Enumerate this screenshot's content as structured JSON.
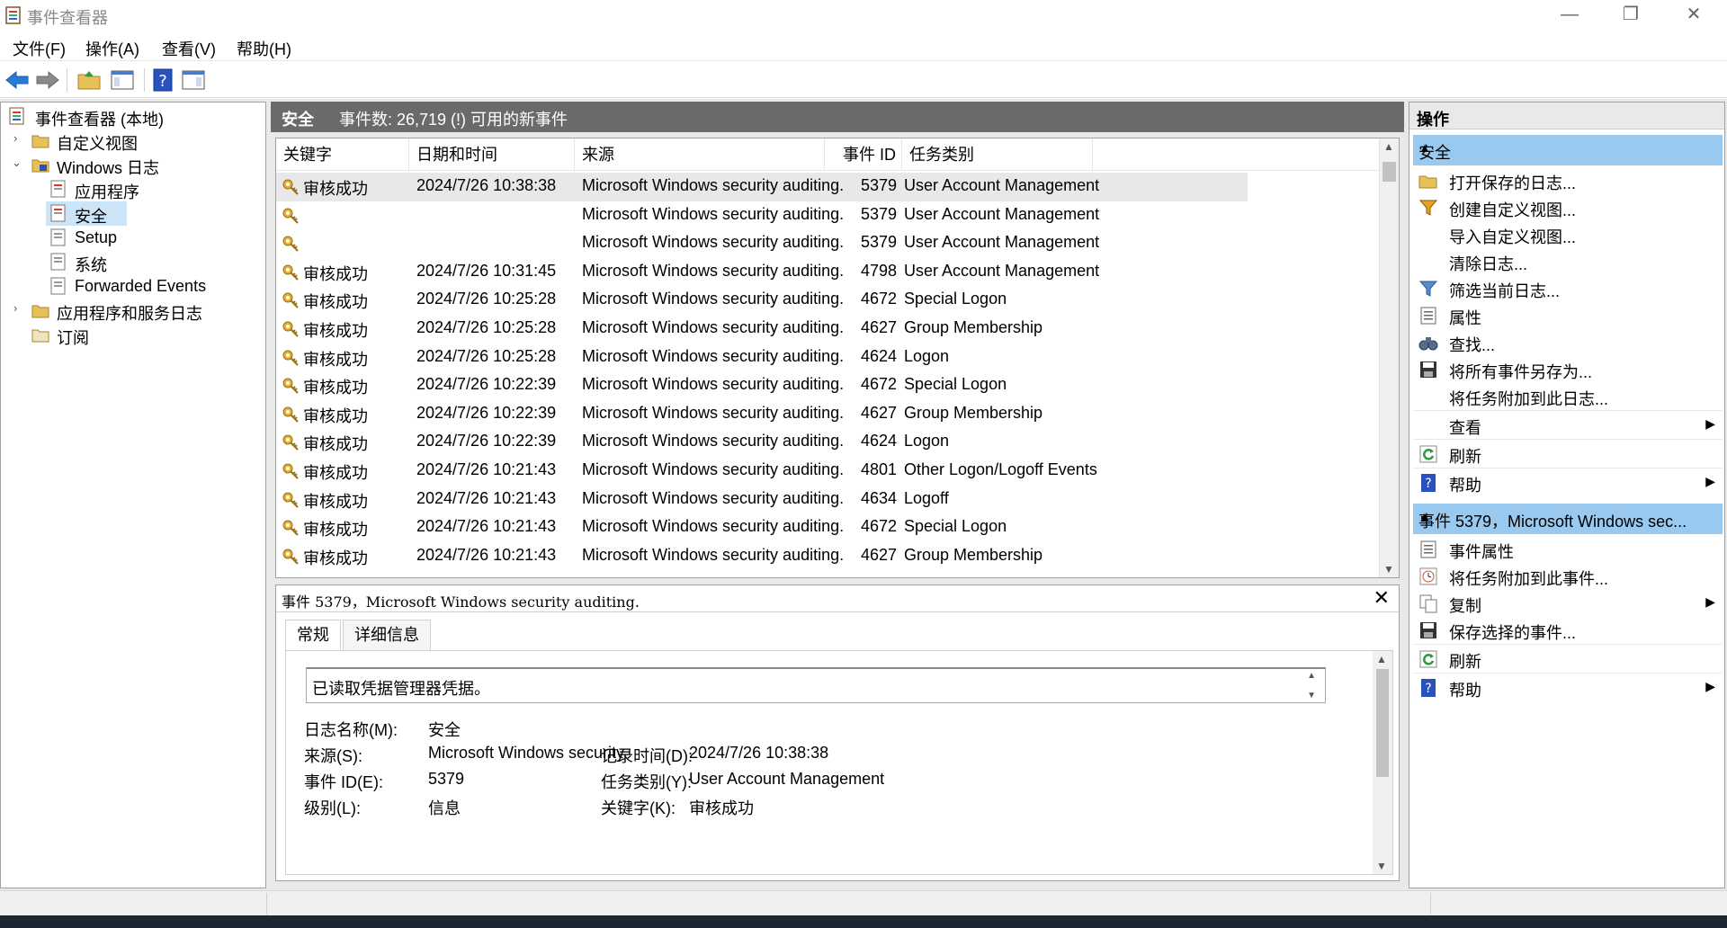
{
  "window": {
    "title": "事件查看器"
  },
  "menu": [
    "文件(F)",
    "操作(A)",
    "查看(V)",
    "帮助(H)"
  ],
  "tree": {
    "root": "事件查看器 (本地)",
    "custom_views": "自定义视图",
    "windows_logs": "Windows 日志",
    "application": "应用程序",
    "security": "安全",
    "setup": "Setup",
    "system": "系统",
    "forwarded": "Forwarded Events",
    "apps_services": "应用程序和服务日志",
    "subscriptions": "订阅"
  },
  "center": {
    "title": "安全",
    "count_text": "事件数: 26,719 (!) 可用的新事件"
  },
  "columns": {
    "keyword": "关键字",
    "datetime": "日期和时间",
    "source": "来源",
    "event_id": "事件 ID",
    "task": "任务类别"
  },
  "events": [
    {
      "keyword": "审核成功",
      "datetime": "2024/7/26 10:38:38",
      "source": "Microsoft Windows security auditing.",
      "id": "5379",
      "task": "User Account Management"
    },
    {
      "keyword": "",
      "datetime": "",
      "source": "Microsoft Windows security auditing.",
      "id": "5379",
      "task": "User Account Management"
    },
    {
      "keyword": "",
      "datetime": "",
      "source": "Microsoft Windows security auditing.",
      "id": "5379",
      "task": "User Account Management"
    },
    {
      "keyword": "审核成功",
      "datetime": "2024/7/26 10:31:45",
      "source": "Microsoft Windows security auditing.",
      "id": "4798",
      "task": "User Account Management"
    },
    {
      "keyword": "审核成功",
      "datetime": "2024/7/26 10:25:28",
      "source": "Microsoft Windows security auditing.",
      "id": "4672",
      "task": "Special Logon"
    },
    {
      "keyword": "审核成功",
      "datetime": "2024/7/26 10:25:28",
      "source": "Microsoft Windows security auditing.",
      "id": "4627",
      "task": "Group Membership"
    },
    {
      "keyword": "审核成功",
      "datetime": "2024/7/26 10:25:28",
      "source": "Microsoft Windows security auditing.",
      "id": "4624",
      "task": "Logon"
    },
    {
      "keyword": "审核成功",
      "datetime": "2024/7/26 10:22:39",
      "source": "Microsoft Windows security auditing.",
      "id": "4672",
      "task": "Special Logon"
    },
    {
      "keyword": "审核成功",
      "datetime": "2024/7/26 10:22:39",
      "source": "Microsoft Windows security auditing.",
      "id": "4627",
      "task": "Group Membership"
    },
    {
      "keyword": "审核成功",
      "datetime": "2024/7/26 10:22:39",
      "source": "Microsoft Windows security auditing.",
      "id": "4624",
      "task": "Logon"
    },
    {
      "keyword": "审核成功",
      "datetime": "2024/7/26 10:21:43",
      "source": "Microsoft Windows security auditing.",
      "id": "4801",
      "task": "Other Logon/Logoff Events"
    },
    {
      "keyword": "审核成功",
      "datetime": "2024/7/26 10:21:43",
      "source": "Microsoft Windows security auditing.",
      "id": "4634",
      "task": "Logoff"
    },
    {
      "keyword": "审核成功",
      "datetime": "2024/7/26 10:21:43",
      "source": "Microsoft Windows security auditing.",
      "id": "4672",
      "task": "Special Logon"
    },
    {
      "keyword": "审核成功",
      "datetime": "2024/7/26 10:21:43",
      "source": "Microsoft Windows security auditing.",
      "id": "4627",
      "task": "Group Membership"
    }
  ],
  "details": {
    "title": "事件 5379，Microsoft Windows security auditing.",
    "tab_general": "常规",
    "tab_details": "详细信息",
    "description": "已读取凭据管理器凭据。",
    "log_name_label": "日志名称(M):",
    "log_name": "安全",
    "source_label": "来源(S):",
    "source": "Microsoft Windows security",
    "logged_label": "记录时间(D):",
    "logged": "2024/7/26 10:38:38",
    "event_id_label": "事件 ID(E):",
    "event_id": "5379",
    "task_label": "任务类别(Y):",
    "task": "User Account Management",
    "level_label": "级别(L):",
    "level": "信息",
    "keywords_label": "关键字(K):",
    "keywords": "审核成功"
  },
  "actions": {
    "header": "操作",
    "section1": "安全",
    "open_saved": "打开保存的日志...",
    "create_view": "创建自定义视图...",
    "import_view": "导入自定义视图...",
    "clear_log": "清除日志...",
    "filter_log": "筛选当前日志...",
    "properties": "属性",
    "find": "查找...",
    "save_all": "将所有事件另存为...",
    "attach_task_log": "将任务附加到此日志...",
    "view": "查看",
    "refresh": "刷新",
    "help": "帮助",
    "section2": "事件 5379，Microsoft Windows sec...",
    "event_props": "事件属性",
    "attach_task_event": "将任务附加到此事件...",
    "copy": "复制",
    "save_selected": "保存选择的事件...",
    "refresh2": "刷新",
    "help2": "帮助"
  },
  "colors": {
    "selection": "#cce4f7",
    "section": "#99c9ef",
    "header": "#6a6a6a"
  }
}
